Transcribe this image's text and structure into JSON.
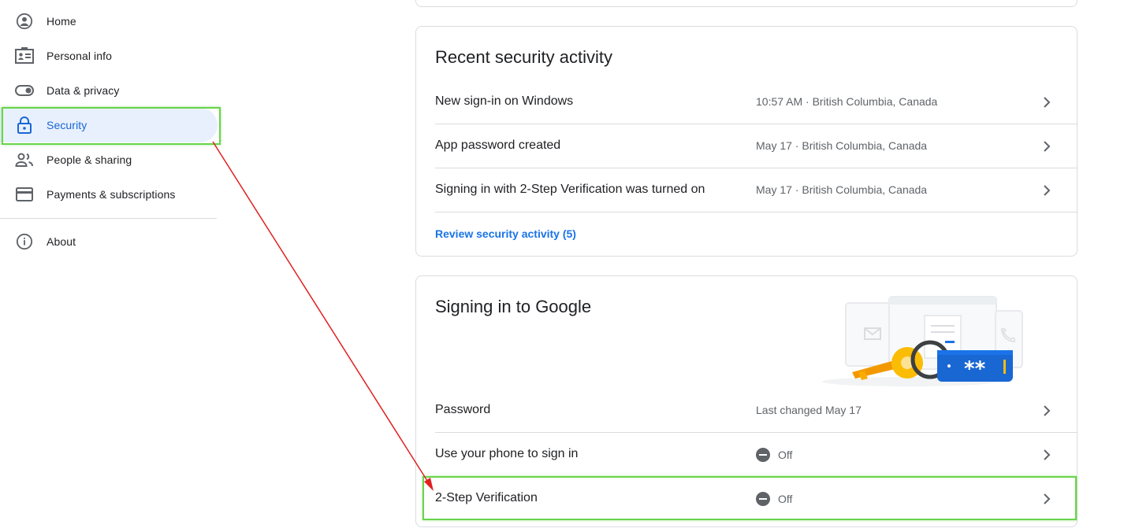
{
  "sidebar": {
    "items": [
      {
        "label": "Home",
        "icon": "account-circle-icon"
      },
      {
        "label": "Personal info",
        "icon": "id-card-icon"
      },
      {
        "label": "Data & privacy",
        "icon": "toggle-icon"
      },
      {
        "label": "Security",
        "icon": "lock-icon",
        "active": true
      },
      {
        "label": "People & sharing",
        "icon": "people-icon"
      },
      {
        "label": "Payments & subscriptions",
        "icon": "credit-card-icon"
      }
    ],
    "about": {
      "label": "About",
      "icon": "info-icon"
    }
  },
  "recent_activity": {
    "title": "Recent security activity",
    "rows": [
      {
        "label": "New sign-in on Windows",
        "meta": "10:57 AM · British Columbia, Canada"
      },
      {
        "label": "App password created",
        "meta": "May 17 · British Columbia, Canada"
      },
      {
        "label": "Signing in with 2-Step Verification was turned on",
        "meta": "May 17 · British Columbia, Canada"
      }
    ],
    "link": "Review security activity (5)"
  },
  "signing_in": {
    "title": "Signing in to Google",
    "rows": [
      {
        "label": "Password",
        "meta": "Last changed May 17"
      },
      {
        "label": "Use your phone to sign in",
        "meta": "Off",
        "status_icon": "off-icon"
      },
      {
        "label": "2-Step Verification",
        "meta": "Off",
        "status_icon": "off-icon"
      }
    ]
  },
  "colors": {
    "accent": "#1a73e8",
    "active_bg": "#e8f0fe",
    "highlight": "#68d44a",
    "annotation_arrow": "#e02020"
  }
}
